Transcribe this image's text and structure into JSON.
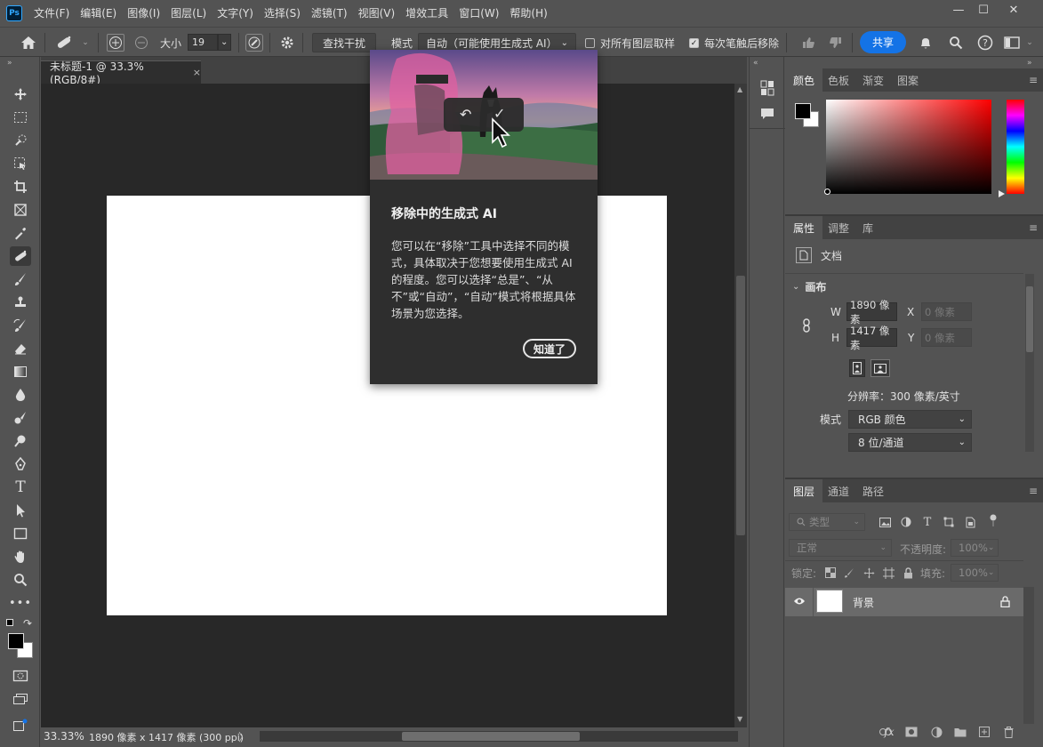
{
  "app": {
    "logo": "Ps",
    "menu": [
      "文件(F)",
      "编辑(E)",
      "图像(I)",
      "图层(L)",
      "文字(Y)",
      "选择(S)",
      "滤镜(T)",
      "视图(V)",
      "增效工具",
      "窗口(W)",
      "帮助(H)"
    ],
    "window_controls": {
      "minimize": "—",
      "maximize": "☐",
      "close": "✕"
    }
  },
  "options": {
    "size_label": "大小",
    "size_value": "19",
    "find_distractions": "查找干扰",
    "mode_label": "模式",
    "mode_value": "自动（可能使用生成式 AI）",
    "sample_all_layers": "对所有图层取样",
    "remove_after_stroke": "每次笔触后移除",
    "share": "共享"
  },
  "document": {
    "tab_title": "未标题-1 @ 33.3%(RGB/8#)",
    "tab_close": "×"
  },
  "status": {
    "zoom": "33.33%",
    "doc_size": "1890 像素 x 1417 像素 (300 ppi)",
    "arrow": "〉"
  },
  "popup": {
    "title": "移除中的生成式 AI",
    "body": "您可以在“移除”工具中选择不同的模式，具体取决于您想要使用生成式 AI 的程度。您可以选择“总是”、“从不”或“自动”，“自动”模式将根据具体场景为您选择。",
    "ok_button": "知道了",
    "undo_icon": "↶",
    "confirm_icon": "✓"
  },
  "color_panel": {
    "tabs": [
      "颜色",
      "色板",
      "渐变",
      "图案"
    ],
    "foreground": "#000000",
    "background": "#ffffff"
  },
  "properties_panel": {
    "tabs": [
      "属性",
      "调整",
      "库"
    ],
    "doc_label": "文档",
    "section": "画布",
    "w_label": "W",
    "w_value": "1890 像素",
    "h_label": "H",
    "h_value": "1417 像素",
    "x_label": "X",
    "x_placeholder": "0 像素",
    "y_label": "Y",
    "y_placeholder": "0 像素",
    "resolution": "分辨率：300 像素/英寸",
    "mode_label": "模式",
    "mode_value": "RGB 颜色",
    "depth_value": "8 位/通道"
  },
  "layers_panel": {
    "tabs": [
      "图层",
      "通道",
      "路径"
    ],
    "filter_label": "类型",
    "blend_mode": "正常",
    "opacity_label": "不透明度:",
    "opacity_value": "100%",
    "lock_label": "锁定:",
    "fill_label": "填充:",
    "fill_value": "100%",
    "layer_name": "背景"
  }
}
